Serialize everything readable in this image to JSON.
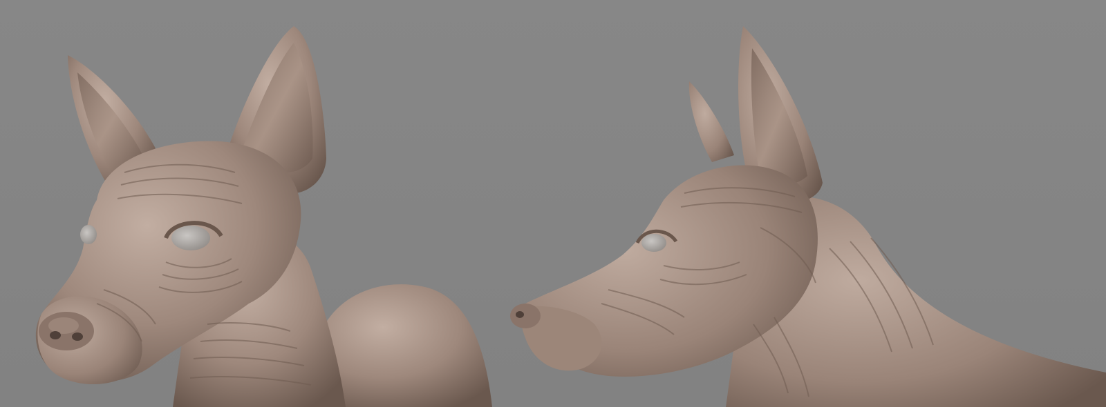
{
  "scene": {
    "background_color": "#858585",
    "clay_light": "#b8a498",
    "clay_mid": "#9b8579",
    "clay_dark": "#6e5c52",
    "eye_color": "#aeaaa6"
  },
  "views": [
    {
      "name": "three-quarter-view",
      "subject": "hairless-dog-head"
    },
    {
      "name": "side-profile-view",
      "subject": "hairless-dog-head"
    }
  ]
}
